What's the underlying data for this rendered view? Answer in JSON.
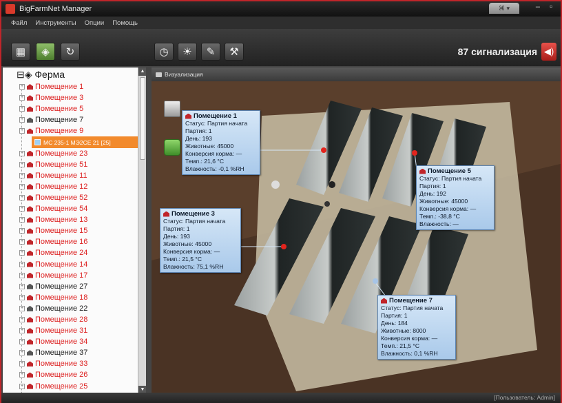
{
  "app": {
    "title": "BigFarmNet Manager",
    "tab_label": "⌘ ▾"
  },
  "menu": [
    "Файл",
    "Инструменты",
    "Опции",
    "Помощь"
  ],
  "toolbar": {
    "alarm_text": "87 сигнализация"
  },
  "tree": {
    "root_label": "Ферма",
    "items": [
      {
        "label": "Помещение 1",
        "status": "red"
      },
      {
        "label": "Помещение 3",
        "status": "red"
      },
      {
        "label": "Помещение 5",
        "status": "red"
      },
      {
        "label": "Помещение 7",
        "status": "gray"
      },
      {
        "label": "Помещение 9",
        "status": "red"
      },
      {
        "label": "МС 235-1 МЭ2СЕ 21 [25]",
        "status": "sub"
      },
      {
        "label": "Помещение 23",
        "status": "red"
      },
      {
        "label": "Помещение 51",
        "status": "red"
      },
      {
        "label": "Помещение 11",
        "status": "red"
      },
      {
        "label": "Помещение 12",
        "status": "red"
      },
      {
        "label": "Помещение 52",
        "status": "red"
      },
      {
        "label": "Помещение 54",
        "status": "red"
      },
      {
        "label": "Помещение 13",
        "status": "red"
      },
      {
        "label": "Помещение 15",
        "status": "red"
      },
      {
        "label": "Помещение 16",
        "status": "red"
      },
      {
        "label": "Помещение 24",
        "status": "red"
      },
      {
        "label": "Помещение 14",
        "status": "red"
      },
      {
        "label": "Помещение 17",
        "status": "red"
      },
      {
        "label": "Помещение 27",
        "status": "gray"
      },
      {
        "label": "Помещение 18",
        "status": "red"
      },
      {
        "label": "Помещение 22",
        "status": "gray"
      },
      {
        "label": "Помещение 28",
        "status": "red"
      },
      {
        "label": "Помещение 31",
        "status": "red"
      },
      {
        "label": "Помещение 34",
        "status": "red"
      },
      {
        "label": "Помещение 37",
        "status": "gray"
      },
      {
        "label": "Помещение 33",
        "status": "red"
      },
      {
        "label": "Помещение 26",
        "status": "red"
      },
      {
        "label": "Помещение 25",
        "status": "red"
      }
    ]
  },
  "visual": {
    "header": "Визуализация"
  },
  "panels": [
    {
      "title": "Помещение 1",
      "lines": [
        "Статус: Партия начата",
        "Партия: 1",
        "День: 193",
        "Животные: 45000",
        "Конверсия корма: —",
        "Темп.: 21,6 °C",
        "Влажность: -0,1 %RH"
      ]
    },
    {
      "title": "Помещение 5",
      "lines": [
        "Статус: Партия начата",
        "Партия: 1",
        "День: 192",
        "Животные: 45000",
        "Конверсия корма: —",
        "Темп.: -38,8 °C",
        "Влажность: —"
      ]
    },
    {
      "title": "Помещение 3",
      "lines": [
        "Статус: Партия начата",
        "Партия: 1",
        "День: 193",
        "Животные: 45000",
        "Конверсия корма: —",
        "Темп.: 21,5 °C",
        "Влажность: 75,1 %RH"
      ]
    },
    {
      "title": "Помещение 7",
      "lines": [
        "Статус: Партия начата",
        "Партия: 1",
        "День: 184",
        "Животные: 8000",
        "Конверсия корма: —",
        "Темп.: 21,5 °C",
        "Влажность: 0,1 %RH"
      ]
    }
  ],
  "status": {
    "user": "[Пользователь: Admin]"
  },
  "colors": {
    "alarm": "#c0252a",
    "tree_active": "#f28a2c",
    "panel": "#bcd6f0"
  }
}
